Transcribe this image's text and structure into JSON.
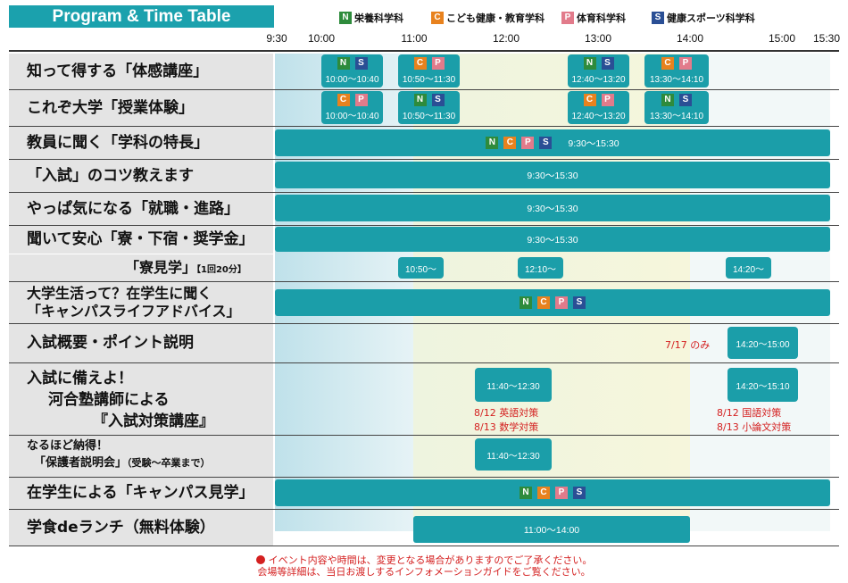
{
  "title": "Program & Time Table",
  "legend": [
    {
      "code": "N",
      "label": "栄養科学科",
      "color": "#2e8b3c"
    },
    {
      "code": "C",
      "label": "こども健康・教育学科",
      "color": "#e8821e"
    },
    {
      "code": "P",
      "label": "体育科学科",
      "color": "#e27b8b"
    },
    {
      "code": "S",
      "label": "健康スポーツ科学科",
      "color": "#2a4f95"
    }
  ],
  "time_ticks": [
    "9:30",
    "10:00",
    "11:00",
    "12:00",
    "13:00",
    "14:00",
    "15:00",
    "15:30"
  ],
  "rows": {
    "r1": {
      "label": "知って得する「体感講座」",
      "slots": [
        {
          "codes": [
            "N",
            "S"
          ],
          "time": "10:00〜10:40"
        },
        {
          "codes": [
            "C",
            "P"
          ],
          "time": "10:50〜11:30"
        },
        {
          "codes": [
            "N",
            "S"
          ],
          "time": "12:40〜13:20"
        },
        {
          "codes": [
            "C",
            "P"
          ],
          "time": "13:30〜14:10"
        }
      ]
    },
    "r2": {
      "label": "これぞ大学「授業体験」",
      "slots": [
        {
          "codes": [
            "C",
            "P"
          ],
          "time": "10:00〜10:40"
        },
        {
          "codes": [
            "N",
            "S"
          ],
          "time": "10:50〜11:30"
        },
        {
          "codes": [
            "C",
            "P"
          ],
          "time": "12:40〜13:20"
        },
        {
          "codes": [
            "N",
            "S"
          ],
          "time": "13:30〜14:10"
        }
      ]
    },
    "r3": {
      "label": "教員に聞く「学科の特長」",
      "codes": [
        "N",
        "C",
        "P",
        "S"
      ],
      "time": "9:30〜15:30"
    },
    "r4": {
      "label": "「入試」のコツ教えます",
      "time": "9:30〜15:30"
    },
    "r5": {
      "label": "やっぱ気になる「就職・進路」",
      "time": "9:30〜15:30"
    },
    "r6": {
      "label": "聞いて安心「寮・下宿・奨学金」",
      "time": "9:30〜15:30"
    },
    "r7": {
      "label": "「寮見学」",
      "note": "【1回20分】",
      "slots": [
        {
          "time": "10:50〜"
        },
        {
          "time": "12:10〜"
        },
        {
          "time": "14:20〜"
        }
      ]
    },
    "r8": {
      "label1": "大学生活って？在学生に聞く",
      "label2": "「キャンパスライフアドバイス」",
      "codes": [
        "N",
        "C",
        "P",
        "S"
      ]
    },
    "r9": {
      "label": "入試概要・ポイント説明",
      "note": "7/17 のみ",
      "time": "14:20〜15:00"
    },
    "r10": {
      "label1": "入試に備えよ！",
      "label2": "河合塾講師による",
      "label3": "『入試対策講座』",
      "slot1": {
        "time": "11:40〜12:30",
        "notes": [
          "8/12 英語対策",
          "8/13 数学対策"
        ]
      },
      "slot2": {
        "time": "14:20〜15:10",
        "notes": [
          "8/12 国語対策",
          "8/13 小論文対策"
        ]
      }
    },
    "r11": {
      "label1": "なるほど納得！",
      "label2": "「保護者説明会」",
      "label3": "（受験〜卒業まで）",
      "time": "11:40〜12:30"
    },
    "r12": {
      "label": "在学生による「キャンパス見学」",
      "codes": [
        "N",
        "C",
        "P",
        "S"
      ]
    },
    "r13": {
      "label": "学食deランチ（無料体験）",
      "time": "11:00〜14:00"
    }
  },
  "footer": {
    "line1": "イベント内容や時間は、変更となる場合がありますのでご了承ください。",
    "line2": "会場等詳細は、当日お渡しするインフォメーションガイドをご覧ください。"
  },
  "colors": {
    "accent": "#1b9ea9",
    "band_blue": "#d2eaf0",
    "band_yellow": "#f3f3d8",
    "label_bg": "#e4e4e4",
    "note_red": "#d42020"
  }
}
